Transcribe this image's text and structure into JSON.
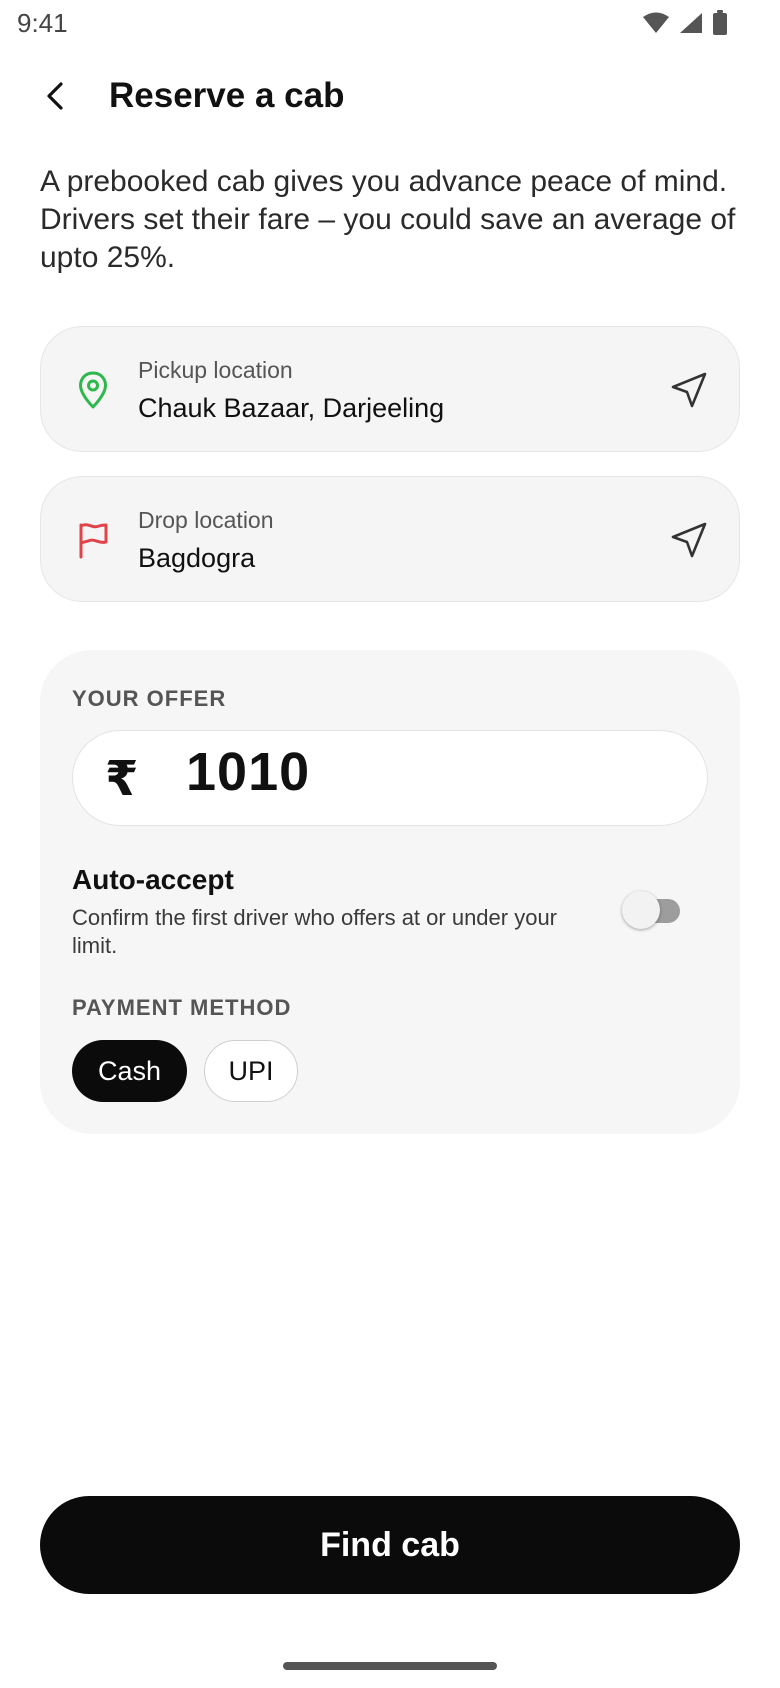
{
  "status_bar": {
    "time": "9:41",
    "icons": [
      "wifi-icon",
      "cellular-signal-icon",
      "battery-icon"
    ]
  },
  "app_bar": {
    "back_icon": "back-arrow-icon",
    "title": "Reserve a cab"
  },
  "intro": {
    "text": "A prebooked cab gives you advance peace of mind. Drivers set their fare – you could save an average of upto 25%."
  },
  "pickup": {
    "icon": "map-pin-icon",
    "icon_color": "#2db84c",
    "label": "Pickup location",
    "value": "Chauk Bazaar, Darjeeling",
    "action_icon": "navigation-arrow-icon"
  },
  "drop": {
    "icon": "flag-icon",
    "icon_color": "#e0444a",
    "label": "Drop location",
    "value": "Bagdogra",
    "action_icon": "navigation-arrow-icon"
  },
  "offer": {
    "label": "YOUR OFFER",
    "currency_symbol": "₹",
    "amount": "1010"
  },
  "auto_accept": {
    "title": "Auto-accept",
    "description": "Confirm the first driver who offers at or under your limit.",
    "enabled": false
  },
  "payment": {
    "label": "PAYMENT METHOD",
    "options": [
      {
        "label": "Cash",
        "selected": true
      },
      {
        "label": "UPI",
        "selected": false
      }
    ]
  },
  "cta": {
    "label": "Find cab"
  },
  "colors": {
    "primary": "#0b0b0b",
    "surface": "#f5f5f5",
    "pickup_accent": "#2db84c",
    "drop_accent": "#e0444a"
  }
}
